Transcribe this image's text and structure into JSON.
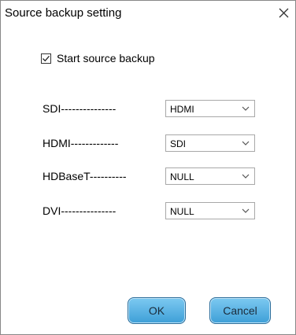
{
  "dialog": {
    "title": "Source backup setting",
    "close_icon": "close-icon"
  },
  "checkbox": {
    "label": "Start source backup",
    "checked": true
  },
  "rows": [
    {
      "label": "SDI---------------",
      "value": "HDMI"
    },
    {
      "label": "HDMI-------------",
      "value": "SDI"
    },
    {
      "label": "HDBaseT----------",
      "value": "NULL"
    },
    {
      "label": "DVI---------------",
      "value": "NULL"
    }
  ],
  "buttons": {
    "ok_label": "OK",
    "cancel_label": "Cancel"
  },
  "colors": {
    "button_fill": "#5ab3e5",
    "button_border": "#2a6c9a"
  }
}
